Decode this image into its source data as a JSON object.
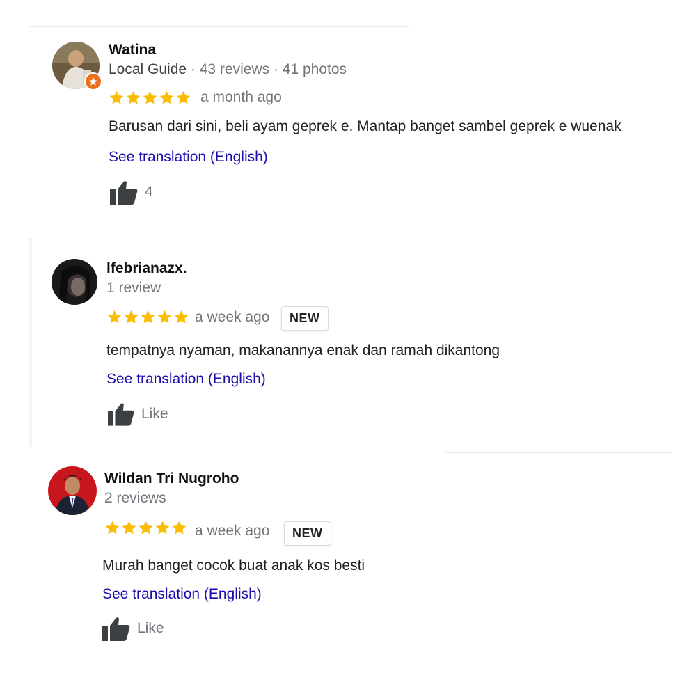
{
  "colors": {
    "star": "#fbbc04",
    "link": "#1a0dab",
    "muted": "#70757a",
    "guide_badge": "#e8711e",
    "thumb": "#3c4043"
  },
  "reviews": [
    {
      "name": "Watina",
      "meta_guide": "Local Guide",
      "meta_rest": " · 43 reviews · 41 photos",
      "rating": 5,
      "when": "a month ago",
      "text": "Barusan dari sini, beli ayam geprek e. Mantap banget sambel geprek e wuenak",
      "translate": "See translation (English)",
      "likes": "4",
      "avatar_icon": "profile-photo"
    },
    {
      "name": "lfebrianazx.",
      "meta_rest": "1 review",
      "rating": 5,
      "when": "a week ago",
      "badge": "NEW",
      "text": "tempatnya nyaman, makanannya enak dan ramah dikantong",
      "translate": "See translation (English)",
      "likes": "Like",
      "avatar_icon": "profile-photo"
    },
    {
      "name": "Wildan Tri Nugroho",
      "meta_rest": "2 reviews",
      "rating": 5,
      "when": "a week ago",
      "badge": "NEW",
      "text": "Murah banget cocok buat anak kos besti",
      "translate": "See translation (English)",
      "likes": "Like",
      "avatar_icon": "profile-photo"
    }
  ]
}
